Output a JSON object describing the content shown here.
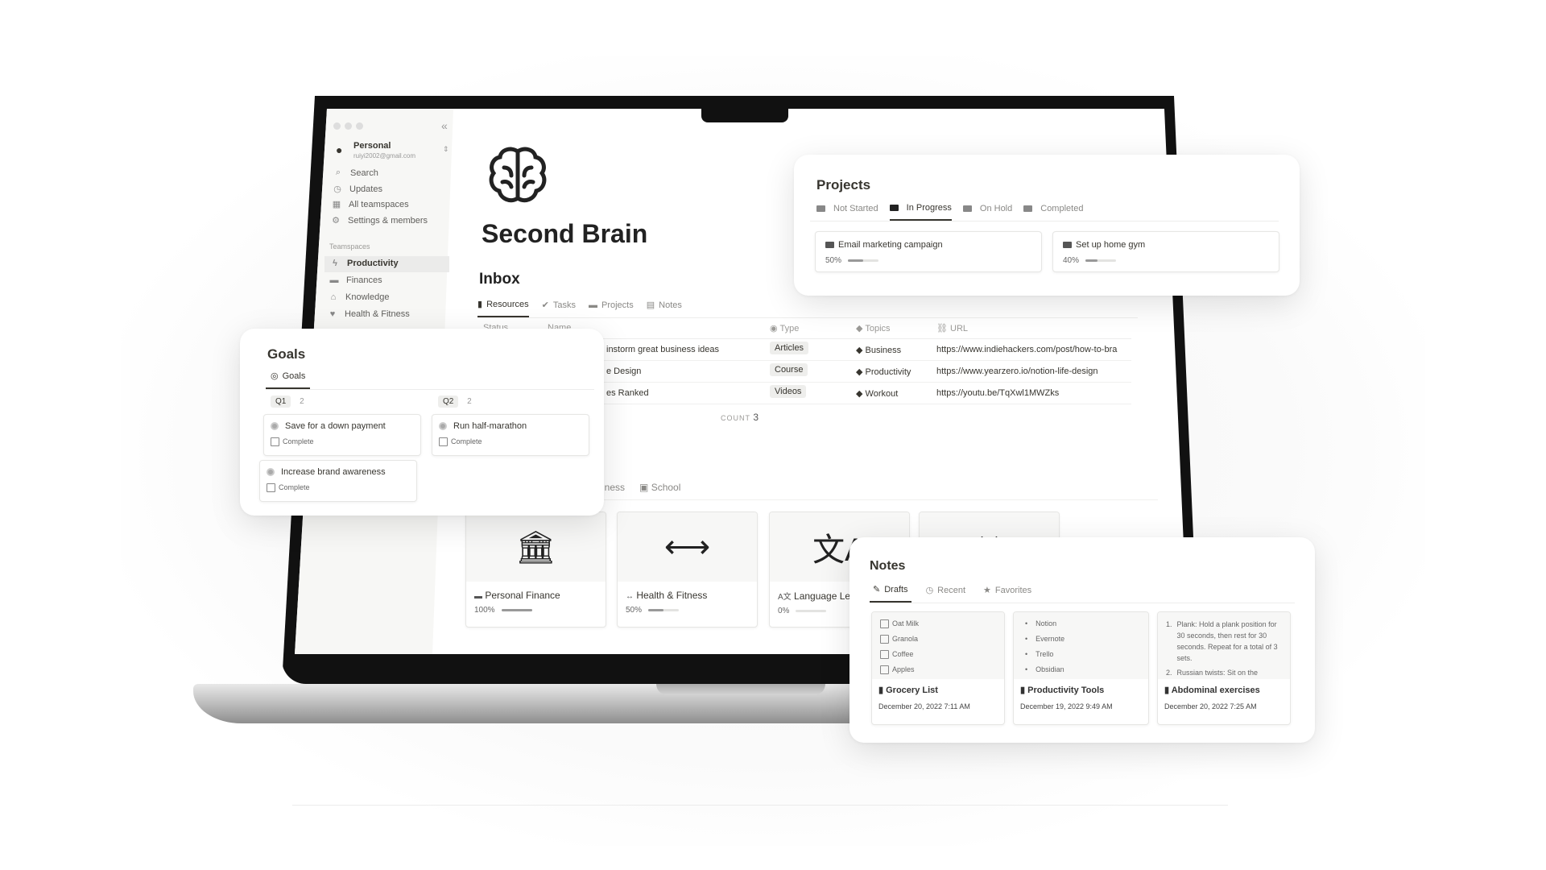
{
  "sidebar": {
    "workspace": "Personal",
    "email": "ruiyi2002@gmail.com",
    "nav": [
      {
        "label": "Search",
        "icon": "search-icon"
      },
      {
        "label": "Updates",
        "icon": "clock-icon"
      },
      {
        "label": "All teamspaces",
        "icon": "building-icon"
      },
      {
        "label": "Settings & members",
        "icon": "gear-icon"
      }
    ],
    "section": "Teamspaces",
    "teamspaces": [
      {
        "label": "Productivity",
        "icon": "bolt-icon",
        "active": true
      },
      {
        "label": "Finances",
        "icon": "card-icon"
      },
      {
        "label": "Knowledge",
        "icon": "bank-icon"
      },
      {
        "label": "Health & Fitness",
        "icon": "heart-icon"
      }
    ]
  },
  "page": {
    "title": "Second Brain",
    "icon": "brain-icon"
  },
  "inbox": {
    "title": "Inbox",
    "tabs": [
      "Resources",
      "Tasks",
      "Projects",
      "Notes"
    ],
    "active_tab": "Resources",
    "columns": [
      "Status",
      "Name",
      "Type",
      "Topics",
      "URL"
    ],
    "rows": [
      {
        "name": "instorm great business ideas",
        "type": "Articles",
        "topic": "Business",
        "url": "https://www.indiehackers.com/post/how-to-bra"
      },
      {
        "name": "e Design",
        "type": "Course",
        "topic": "Productivity",
        "url": "https://www.yearzero.io/notion-life-design"
      },
      {
        "name": "es Ranked",
        "type": "Videos",
        "topic": "Workout",
        "url": "https://youtu.be/TqXwl1MWZks"
      }
    ],
    "count_label": "COUNT",
    "count": "3"
  },
  "areas": {
    "tabs": [
      "iness",
      "School"
    ],
    "cards": [
      {
        "title": "Personal Finance",
        "icon": "bank-icon",
        "progress": 100,
        "pct": "100%"
      },
      {
        "title": "Health & Fitness",
        "icon": "dumbbell-icon",
        "progress": 50,
        "pct": "50%"
      },
      {
        "title": "Language Lea",
        "icon": "translate-icon",
        "progress": 0,
        "pct": "0%"
      },
      {
        "title": "",
        "icon": "ribbon-icon"
      }
    ]
  },
  "projects": {
    "title": "Projects",
    "tabs": [
      "Not Started",
      "In Progress",
      "On Hold",
      "Completed"
    ],
    "active_tab": "In Progress",
    "items": [
      {
        "title": "Email marketing campaign",
        "progress": 50,
        "pct": "50%"
      },
      {
        "title": "Set up home gym",
        "progress": 40,
        "pct": "40%"
      }
    ]
  },
  "goals": {
    "title": "Goals",
    "tab": "Goals",
    "groups": [
      {
        "label": "Q1",
        "count": "2"
      },
      {
        "label": "Q2",
        "count": "2"
      }
    ],
    "items": [
      {
        "title": "Save for a down payment",
        "check": "Complete"
      },
      {
        "title": "Run half-marathon",
        "check": "Complete"
      },
      {
        "title": "Increase brand awareness",
        "check": "Complete"
      }
    ]
  },
  "notes": {
    "title": "Notes",
    "tabs": [
      "Drafts",
      "Recent",
      "Favorites"
    ],
    "active_tab": "Drafts",
    "items": [
      {
        "title": "Grocery List",
        "date": "December 20, 2022 7:11 AM",
        "preview": [
          "Oat Milk",
          "Granola",
          "Coffee",
          "Apples"
        ]
      },
      {
        "title": "Productivity Tools",
        "date": "December 19, 2022 9:49 AM",
        "preview": [
          "Notion",
          "Evernote",
          "Trello",
          "Obsidian"
        ]
      },
      {
        "title": "Abdominal exercises",
        "date": "December 20, 2022 7:25 AM",
        "preview": [
          "Plank: Hold a plank position for 30 seconds, then rest for 30 seconds. Repeat for a total of 3 sets.",
          "Russian twists: Sit on the"
        ]
      }
    ]
  }
}
